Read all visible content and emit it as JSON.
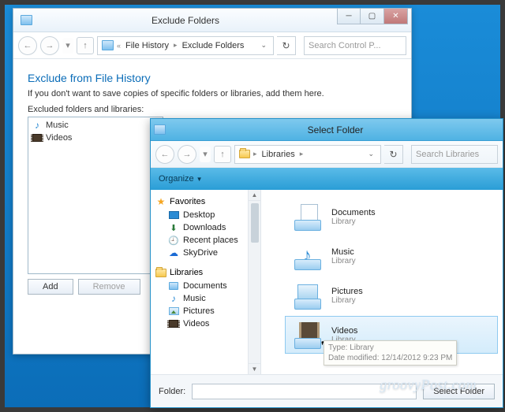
{
  "win1": {
    "title": "Exclude Folders",
    "crumb_root": "File History",
    "crumb_leaf": "Exclude Folders",
    "search_placeholder": "Search Control P...",
    "heading": "Exclude from File History",
    "subtitle": "If you don't want to save copies of specific folders or libraries, add them here.",
    "list_label": "Excluded folders and libraries:",
    "items": [
      {
        "name": "Music"
      },
      {
        "name": "Videos"
      }
    ],
    "add_btn": "Add",
    "remove_btn": "Remove"
  },
  "win2": {
    "title": "Select Folder",
    "crumb_root": "Libraries",
    "search_placeholder": "Search Libraries",
    "organize": "Organize",
    "sidebar": {
      "favorites": {
        "label": "Favorites",
        "items": [
          "Desktop",
          "Downloads",
          "Recent places",
          "SkyDrive"
        ]
      },
      "libraries": {
        "label": "Libraries",
        "items": [
          "Documents",
          "Music",
          "Pictures",
          "Videos"
        ]
      }
    },
    "libs": [
      {
        "name": "Documents",
        "sub": "Library"
      },
      {
        "name": "Music",
        "sub": "Library"
      },
      {
        "name": "Pictures",
        "sub": "Library"
      },
      {
        "name": "Videos",
        "sub": "Library"
      }
    ],
    "tooltip_l1": "Type: Library",
    "tooltip_l2": "Date modified: 12/14/2012 9:23 PM",
    "folder_label": "Folder:",
    "select_btn": "Select Folder"
  },
  "watermark": "groovyPost.com"
}
